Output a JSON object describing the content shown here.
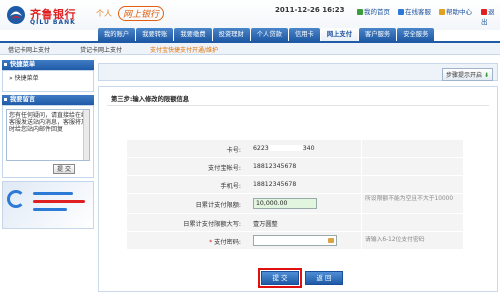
{
  "brand": {
    "name_cn": "齐鲁银行",
    "name_en": "QILU BANK",
    "personal": "个人",
    "online": "网上银行",
    "accent": "#1f5aa6",
    "red": "#e02020"
  },
  "header": {
    "date": "2011-12-26 16:23",
    "links": [
      "我的首页",
      "在线客服",
      "帮助中心",
      "退出"
    ]
  },
  "main_nav": [
    "我的账户",
    "我要转账",
    "我要缴费",
    "投资理财",
    "个人贷款",
    "信用卡",
    "网上支付",
    "客户服务",
    "安全服务"
  ],
  "main_nav_active": "网上支付",
  "sub_nav": [
    "借记卡网上支付",
    "贷记卡网上支付",
    "支付宝快捷支付开通/维护"
  ],
  "sidebar": {
    "menu_title": "快捷菜单",
    "menu_items": [
      "快捷菜单"
    ],
    "msg_title": "我要留言",
    "msg_text": "您有任何疑问，请直接给在线客服发送站内消息，客服将及时给您站内邮件回复",
    "submit_label": "提 交"
  },
  "content": {
    "help_button": "步骤提示开启",
    "step_title": "第三步:输入修改的限额信息",
    "fields": {
      "card_label": "卡号:",
      "card_prefix": "6223",
      "card_suffix": "340",
      "alipay_label": "支付宝帐号:",
      "alipay_value": "18812345678",
      "phone_label": "手机号:",
      "phone_value": "18812345678",
      "daily_limit_label": "日累计支付限额:",
      "daily_limit_value": "10,000.00",
      "daily_limit_hint": "所设限额不能为空且不大于10000",
      "daily_upper_label": "日累计支付限额大写:",
      "daily_upper_value": "壹万圆整",
      "pay_pw_label": "支付密码:",
      "pay_pw_hint": "请输入6-12位支付密码"
    },
    "submit_label": "提 交",
    "back_label": "返 回"
  }
}
